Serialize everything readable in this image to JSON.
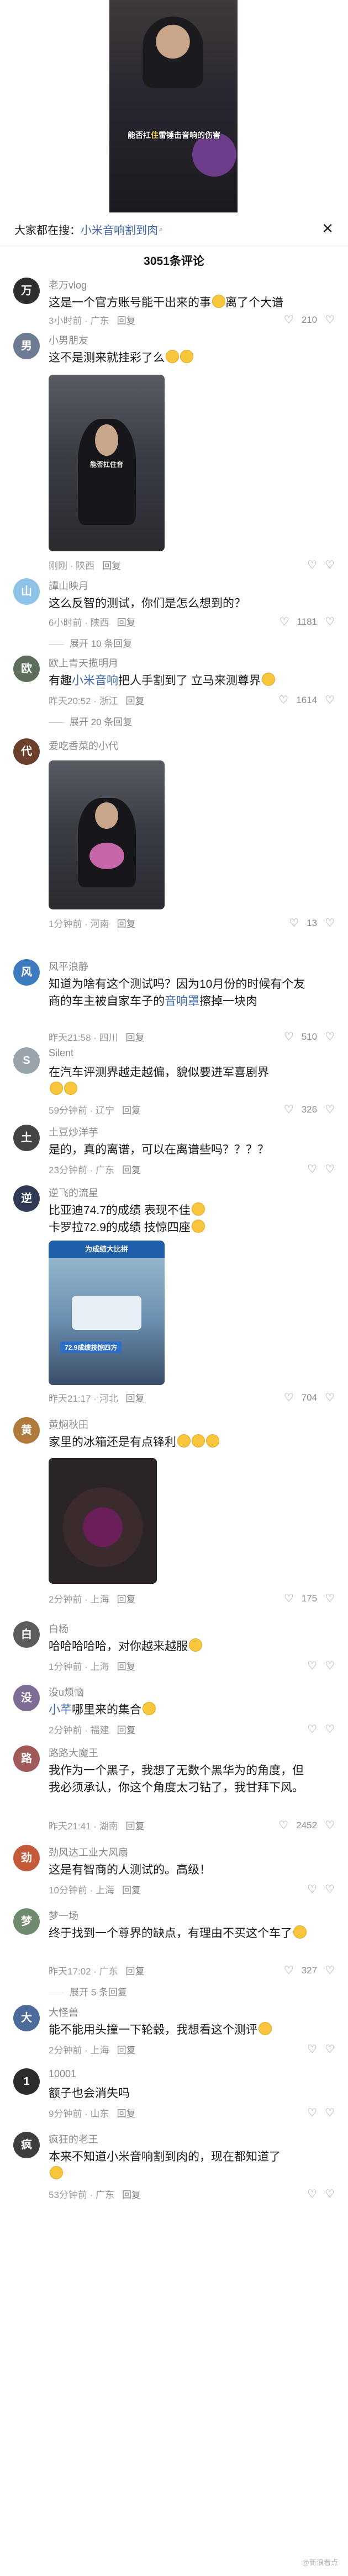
{
  "video": {
    "caption_prefix": "能否扛",
    "caption_highlight": "住",
    "caption_suffix": "雷锤击音响",
    "caption_tail": "的伤害"
  },
  "search": {
    "prefix": "大家都在搜：",
    "term": "小米音响割到肉",
    "close_icon": "close-icon"
  },
  "comment_count": "3051条评论",
  "reply_label": "回复",
  "comments": [
    {
      "user": "老万vlog",
      "avatar_color": "#2e2e2e",
      "avatar_char": "万",
      "text": "这是一个官方账号能干出来的事",
      "text_after": "离了个大谱",
      "meta": "3小时前 · 广东",
      "likes": "210"
    },
    {
      "user": "小男朋友",
      "avatar_color": "#6d7c93",
      "avatar_char": "男",
      "text": "这不是测来就挂彩了么",
      "meta": "刚刚 · 陕西",
      "likes": "",
      "image_caption": "能否扛住音"
    },
    {
      "user": "譚山映月",
      "avatar_color": "#8ec3e8",
      "avatar_char": "山",
      "text": "这么反智的测试，你们是怎么想到的？",
      "meta": "6小时前 · 陕西",
      "likes": "1181",
      "expand": "展开 10 条回复"
    },
    {
      "user": "欧上青天揽明月",
      "avatar_color": "#5b6f5a",
      "avatar_char": "欧",
      "text_before": "有趣",
      "keyword": "小米音响",
      "text": "把人手割到了 立马来测尊界",
      "meta": "昨天20:52 · 浙江",
      "likes": "1614",
      "expand": "展开 20 条回复"
    },
    {
      "user": "爱吃香菜的小代",
      "avatar_color": "#6b3f2b",
      "avatar_char": "代",
      "text": "",
      "meta": "1分钟前 · 河南",
      "likes": "13",
      "image_caption": "能否扛住音"
    },
    {
      "user": "风平浪静",
      "avatar_color": "#3c7bbf",
      "avatar_char": "风",
      "text": "知道为啥有这个测试吗？因为10月份的时候有个友商的车主被自家车子的",
      "keyword": "音响罩",
      "text_after": "擦掉一块肉",
      "meta": "昨天21:58 · 四川",
      "likes": "510"
    },
    {
      "user": "Silent",
      "avatar_color": "#9aa4ad",
      "avatar_char": "S",
      "text": "在汽车评测界越走越偏，貌似要进军喜剧界",
      "meta": "59分钟前 · 辽宁",
      "likes": "326"
    },
    {
      "user": "土豆炒洋芋",
      "avatar_color": "#444444",
      "avatar_char": "土",
      "text": "是的，真的离谱，可以在离谱些吗？？？？",
      "meta": "23分钟前 · 广东",
      "likes": ""
    },
    {
      "user": "逆飞的流星",
      "avatar_color": "#2f3b52",
      "avatar_char": "逆",
      "text": "比亚迪74.7的成绩 表现不佳",
      "text_line2": "卡罗拉72.9的成绩 技惊四座",
      "meta": "昨天21:17 · 河北",
      "likes": "704",
      "image_caption": "72.9成绩技惊四方",
      "image_band": "为成绩大比拼"
    },
    {
      "user": "黄焖秋田",
      "avatar_color": "#b07a3a",
      "avatar_char": "黄",
      "text": "家里的冰箱还是有点锋利",
      "meta": "2分钟前 · 上海",
      "likes": "175"
    },
    {
      "user": "白杨",
      "avatar_color": "#5c5c5c",
      "avatar_char": "白",
      "text": "哈哈哈哈哈，对你越来越服",
      "meta": "1分钟前 · 上海",
      "likes": ""
    },
    {
      "user": "没u烦恼",
      "avatar_color": "#7e6d95",
      "avatar_char": "没",
      "text_before": "",
      "keyword": "小芊",
      "text": "哪里来的集合",
      "meta": "2分钟前 · 福建",
      "likes": ""
    },
    {
      "user": "路路大魔王",
      "avatar_color": "#a05a5a",
      "avatar_char": "路",
      "text": "我作为一个黑子，我想了无数个黑华为的角度，但我必须承认，你这个角度太刁钻了，我甘拜下风。",
      "meta": "昨天21:41 · 湖南",
      "likes": "2452"
    },
    {
      "user": "劲风达工业大风扇",
      "avatar_color": "#c55a3a",
      "avatar_char": "劲",
      "text": "这是有智商的人测试的。高级！",
      "meta": "10分钟前 · 上海",
      "likes": ""
    },
    {
      "user": "梦一场",
      "avatar_color": "#6f8a6f",
      "avatar_char": "梦",
      "text": "终于找到一个尊界的缺点，有理由不买这个车了",
      "meta": "昨天17:02 · 广东",
      "likes": "327",
      "expand": "展开 5 条回复"
    },
    {
      "user": "大怪兽",
      "avatar_color": "#4b6b9a",
      "avatar_char": "大",
      "text": "能不能用头撞一下轮毂，我想看这个测评",
      "meta": "2分钟前 · 上海",
      "likes": ""
    },
    {
      "user": "10001",
      "avatar_color": "#2c2c2c",
      "avatar_char": "1",
      "text": "额子也会消失吗",
      "meta": "9分钟前 · 山东",
      "likes": ""
    },
    {
      "user": "疯狂的老王",
      "avatar_color": "#3e3e3e",
      "avatar_char": "疯",
      "text": "本来不知道小米音响割到肉的，现在都知道了",
      "meta": "53分钟前 · 广东",
      "likes": ""
    }
  ],
  "watermark": "@新浪看点"
}
